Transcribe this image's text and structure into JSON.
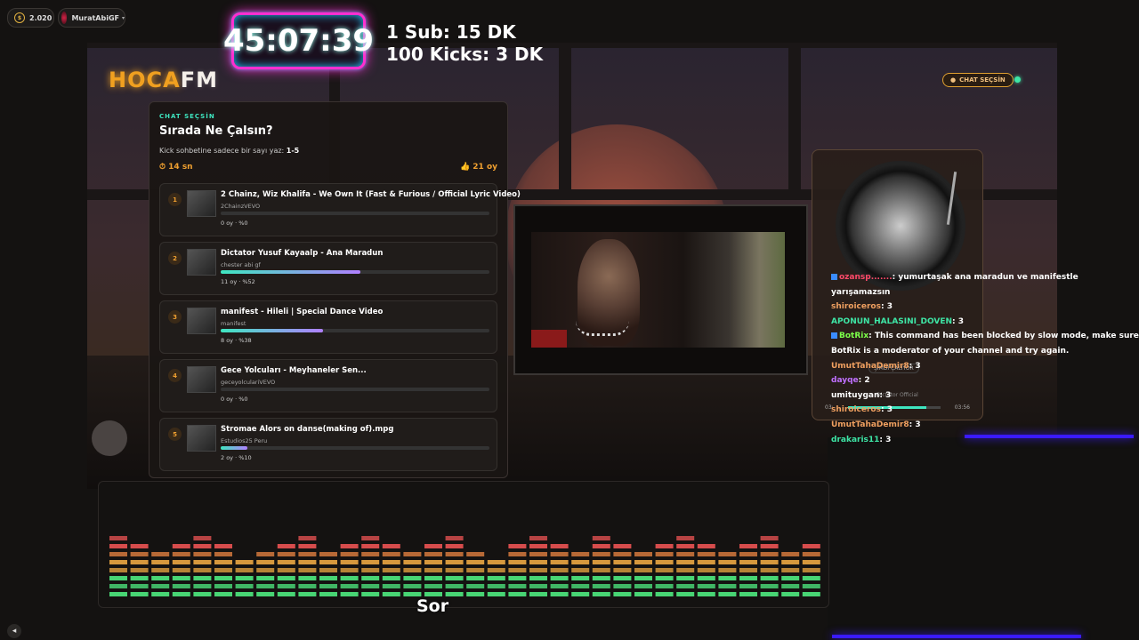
{
  "topbar": {
    "coins": "2.020",
    "username": "MuratAbiGF"
  },
  "timer": "45:07:39",
  "promo": {
    "line1": "1 Sub: 15 DK",
    "line2": "100 Kicks: 3 DK"
  },
  "logo": {
    "part1": "HOCA",
    "part2": "FM"
  },
  "chat_pill": "CHAT SEÇSİN",
  "poll": {
    "label": "CHAT SEÇSİN",
    "title": "Sırada Ne Çalsın?",
    "instruction": "Kick sohbetine sadece bir sayı yaz:",
    "range": "1-5",
    "time_left": "14 sn",
    "total_votes": "21 oy",
    "songs": [
      {
        "num": "1",
        "title": "2 Chainz, Wiz Khalifa - We Own It (Fast & Furious / Official Lyric Video)",
        "channel": "2ChainzVEVO",
        "stat": "0 oy · %0",
        "pct": 0
      },
      {
        "num": "2",
        "title": "Dictator Yusuf Kayaalp - Ana Maradun",
        "channel": "chester abi gf",
        "stat": "11 oy · %52",
        "pct": 52
      },
      {
        "num": "3",
        "title": "manifest - Hileli | Special Dance Video",
        "channel": "manifest",
        "stat": "8 oy · %38",
        "pct": 38
      },
      {
        "num": "4",
        "title": "Gece Yolcuları - Meyhaneler Sen...",
        "channel": "geceyolculariVEVO",
        "stat": "0 oy · %0",
        "pct": 0
      },
      {
        "num": "5",
        "title": "Stromae Alors on danse(making of).mpg",
        "channel": "Estudios25 Peru",
        "stat": "2 oy · %10",
        "pct": 10
      }
    ]
  },
  "player": {
    "now_label": "ŞİMDİ ÇALIYOR",
    "artist": "Dictator Official",
    "time_start": "03:",
    "time_end": "03:56",
    "progress": 0.85
  },
  "chat": [
    {
      "user": "ozansp.......",
      "text": ": yumurtaşak ana maradun ve manifestle yarışamazsın",
      "color": "#ff4a6a"
    },
    {
      "user": "shiroiceros",
      "text": ": 3",
      "color": "#f0a060"
    },
    {
      "user": "APONUN_HALASINI_DOVEN",
      "text": ": 3",
      "color": "#3ee6a6"
    },
    {
      "user": "BotRix",
      "text": ": This command has been blocked by slow mode, make sure BotRix is a moderator of your channel and try again.",
      "color": "#7cff4a"
    },
    {
      "user": "UmutTahaDemir8",
      "text": ": 3",
      "color": "#f0a060"
    },
    {
      "user": "dayqe",
      "text": ": 2",
      "color": "#c070ff"
    },
    {
      "user": "umituygan",
      "text": ": 3",
      "color": "#ffffff"
    },
    {
      "user": "shiroiceros",
      "text": ": 3",
      "color": "#f0a060"
    },
    {
      "user": "UmutTahaDemir8",
      "text": ": 3",
      "color": "#f0a060"
    },
    {
      "user": "drakaris11",
      "text": ": 3",
      "color": "#3ee6a6"
    }
  ],
  "subtitle": "Sor",
  "colors": {
    "accent_orange": "#f0a030",
    "accent_teal": "#3ee6c0",
    "timer_border": "#ff2fd0"
  }
}
